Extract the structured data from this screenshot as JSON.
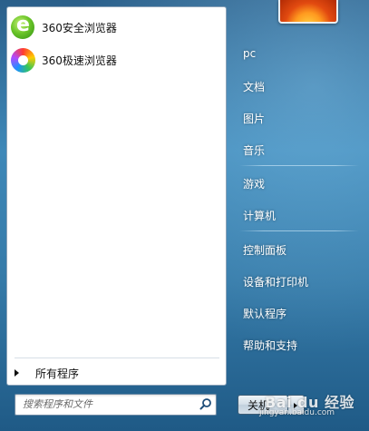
{
  "pinned_programs": [
    {
      "label": "360安全浏览器",
      "icon": "360-safe-browser-icon"
    },
    {
      "label": "360极速浏览器",
      "icon": "360-speed-browser-icon"
    }
  ],
  "all_programs": "所有程序",
  "search": {
    "placeholder": "搜索程序和文件"
  },
  "right_menu": [
    {
      "label": "pc"
    },
    {
      "label": "文档"
    },
    {
      "label": "图片"
    },
    {
      "label": "音乐"
    },
    {
      "label": "游戏"
    },
    {
      "label": "计算机"
    },
    {
      "label": "控制面板"
    },
    {
      "label": "设备和打印机"
    },
    {
      "label": "默认程序"
    },
    {
      "label": "帮助和支持"
    }
  ],
  "shutdown_label": "关机",
  "watermark": {
    "brand": "Bai du 经验",
    "url": "jingyan.baidu.com"
  }
}
